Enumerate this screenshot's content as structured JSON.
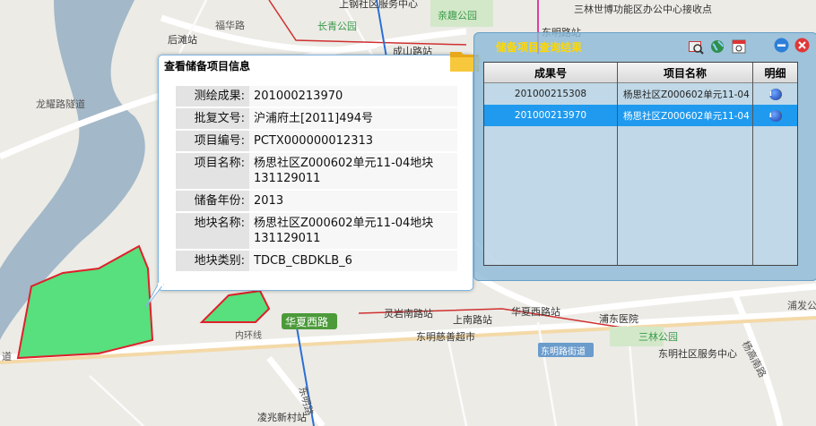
{
  "map": {
    "labels": {
      "houtan": "后滩站",
      "fuhua": "福华路",
      "longyao": "龙耀路隧道",
      "shanggang": "上钢社区服务中心",
      "qinqu": "亲趣公园",
      "changqing": "长青公园",
      "chengshan": "成山路站",
      "sanlin_world": "三林世博功能区办公中心接收点",
      "dongming_station": "东明路站",
      "lingyan": "灵岩南路站",
      "shangnan": "上南路站",
      "huaxia_road_station": "华夏西路站",
      "pudong_hospital": "浦东医院",
      "sanlin_park": "三林公园",
      "huaxia_west": "华夏西路",
      "dongming_super": "东明慈善超市",
      "dongming_street": "东明路街道",
      "dongming_service": "东明社区服务中心",
      "yanggao": "杨高南路",
      "pudong_short": "浦发公",
      "lingzhao": "凌兆新村站",
      "dongming_rd": "东明路",
      "road_left": "道",
      "inner_ring": "内环线"
    }
  },
  "popup": {
    "title": "查看储备项目信息",
    "rows": [
      {
        "label": "测绘成果:",
        "value": "201000213970"
      },
      {
        "label": "批复文号:",
        "value": "沪浦府土[2011]494号"
      },
      {
        "label": "项目编号:",
        "value": "PCTX000000012313"
      },
      {
        "label": "项目名称:",
        "value": "杨思社区Z000602单元11-04地块131129011"
      },
      {
        "label": "储备年份:",
        "value": "2013"
      },
      {
        "label": "地块名称:",
        "value": "杨思社区Z000602单元11-04地块131129011"
      },
      {
        "label": "地块类别:",
        "value": "TDCB_CBDKLB_6"
      }
    ]
  },
  "panel": {
    "title": "储备项目查询结果",
    "columns": {
      "result_no": "成果号",
      "project_name": "项目名称",
      "detail": "明细"
    },
    "rows": [
      {
        "result_no": "201000215308",
        "project_name": "杨思社区Z000602单元11-04",
        "detail_icon": "info-icon"
      },
      {
        "result_no": "201000213970",
        "project_name": "杨思社区Z000602单元11-04",
        "detail_icon": "info-icon"
      }
    ],
    "selected_row": 1
  },
  "colors": {
    "accent": "#1f9aef",
    "panel_title": "#ffd800",
    "river": "#a3b8c8",
    "parcel_fill": "#57e07d",
    "parcel_border": "#e0202a"
  }
}
